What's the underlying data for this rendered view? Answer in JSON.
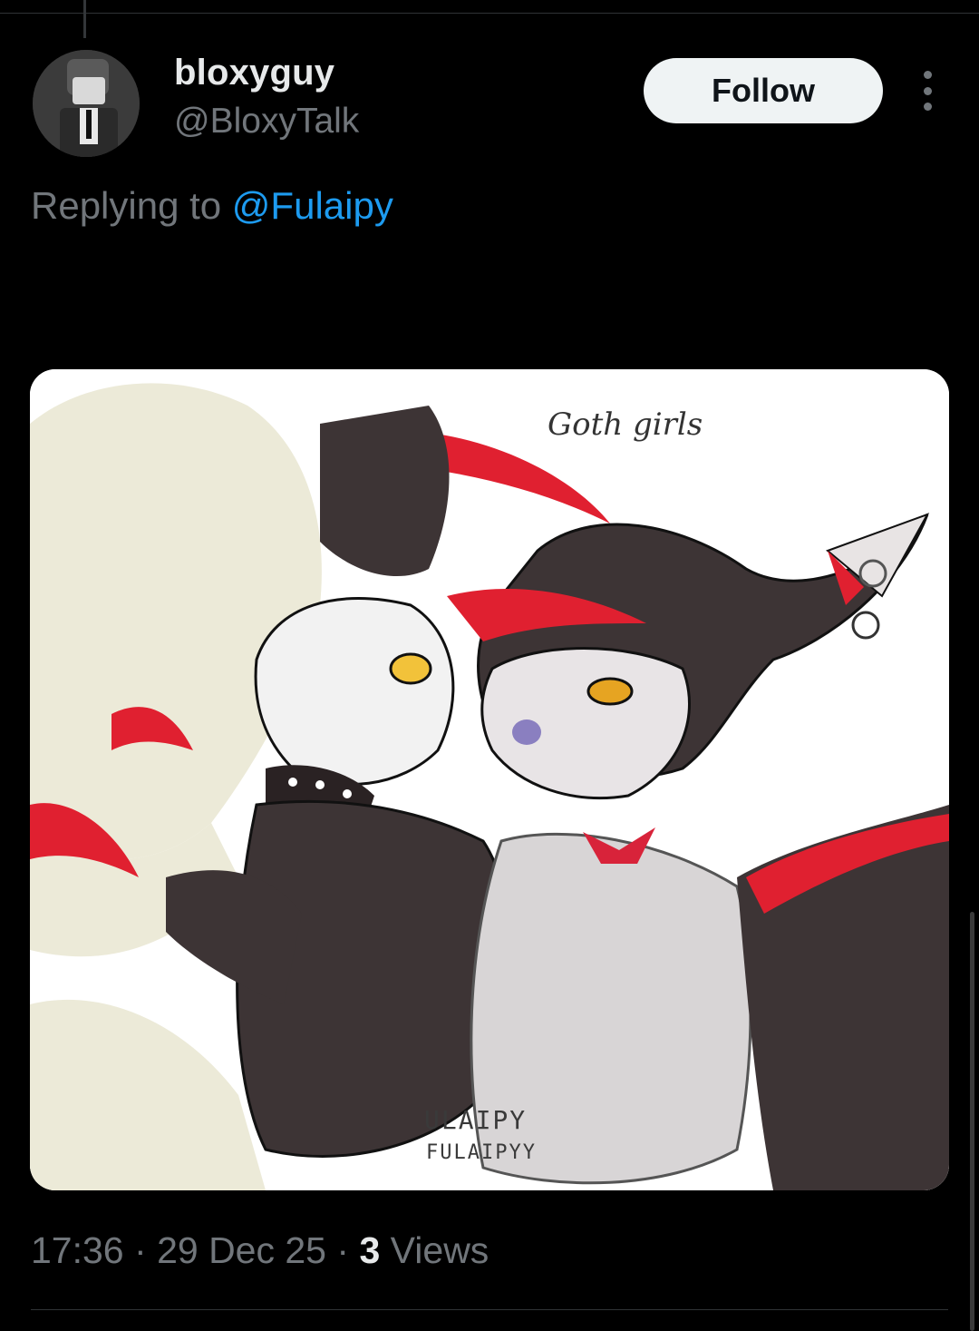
{
  "tweet": {
    "display_name": "bloxyguy",
    "handle": "@BloxyTalk",
    "follow_label": "Follow",
    "replying_prefix": "Replying to ",
    "replying_mention": "@Fulaipy",
    "time": "17:36",
    "date": "29 Dec 25",
    "views_count": "3",
    "views_label": "Views"
  },
  "media": {
    "caption": "Goth girls",
    "watermark_1": "ULAIPY",
    "watermark_2": "FULAIPYY"
  },
  "icons": {
    "more": "more-vertical-icon",
    "avatar": "avatar-image"
  },
  "colors": {
    "background": "#000000",
    "text_primary": "#e7e9ea",
    "text_secondary": "#71767b",
    "link": "#1d9bf0",
    "follow_bg": "#eff3f4"
  }
}
